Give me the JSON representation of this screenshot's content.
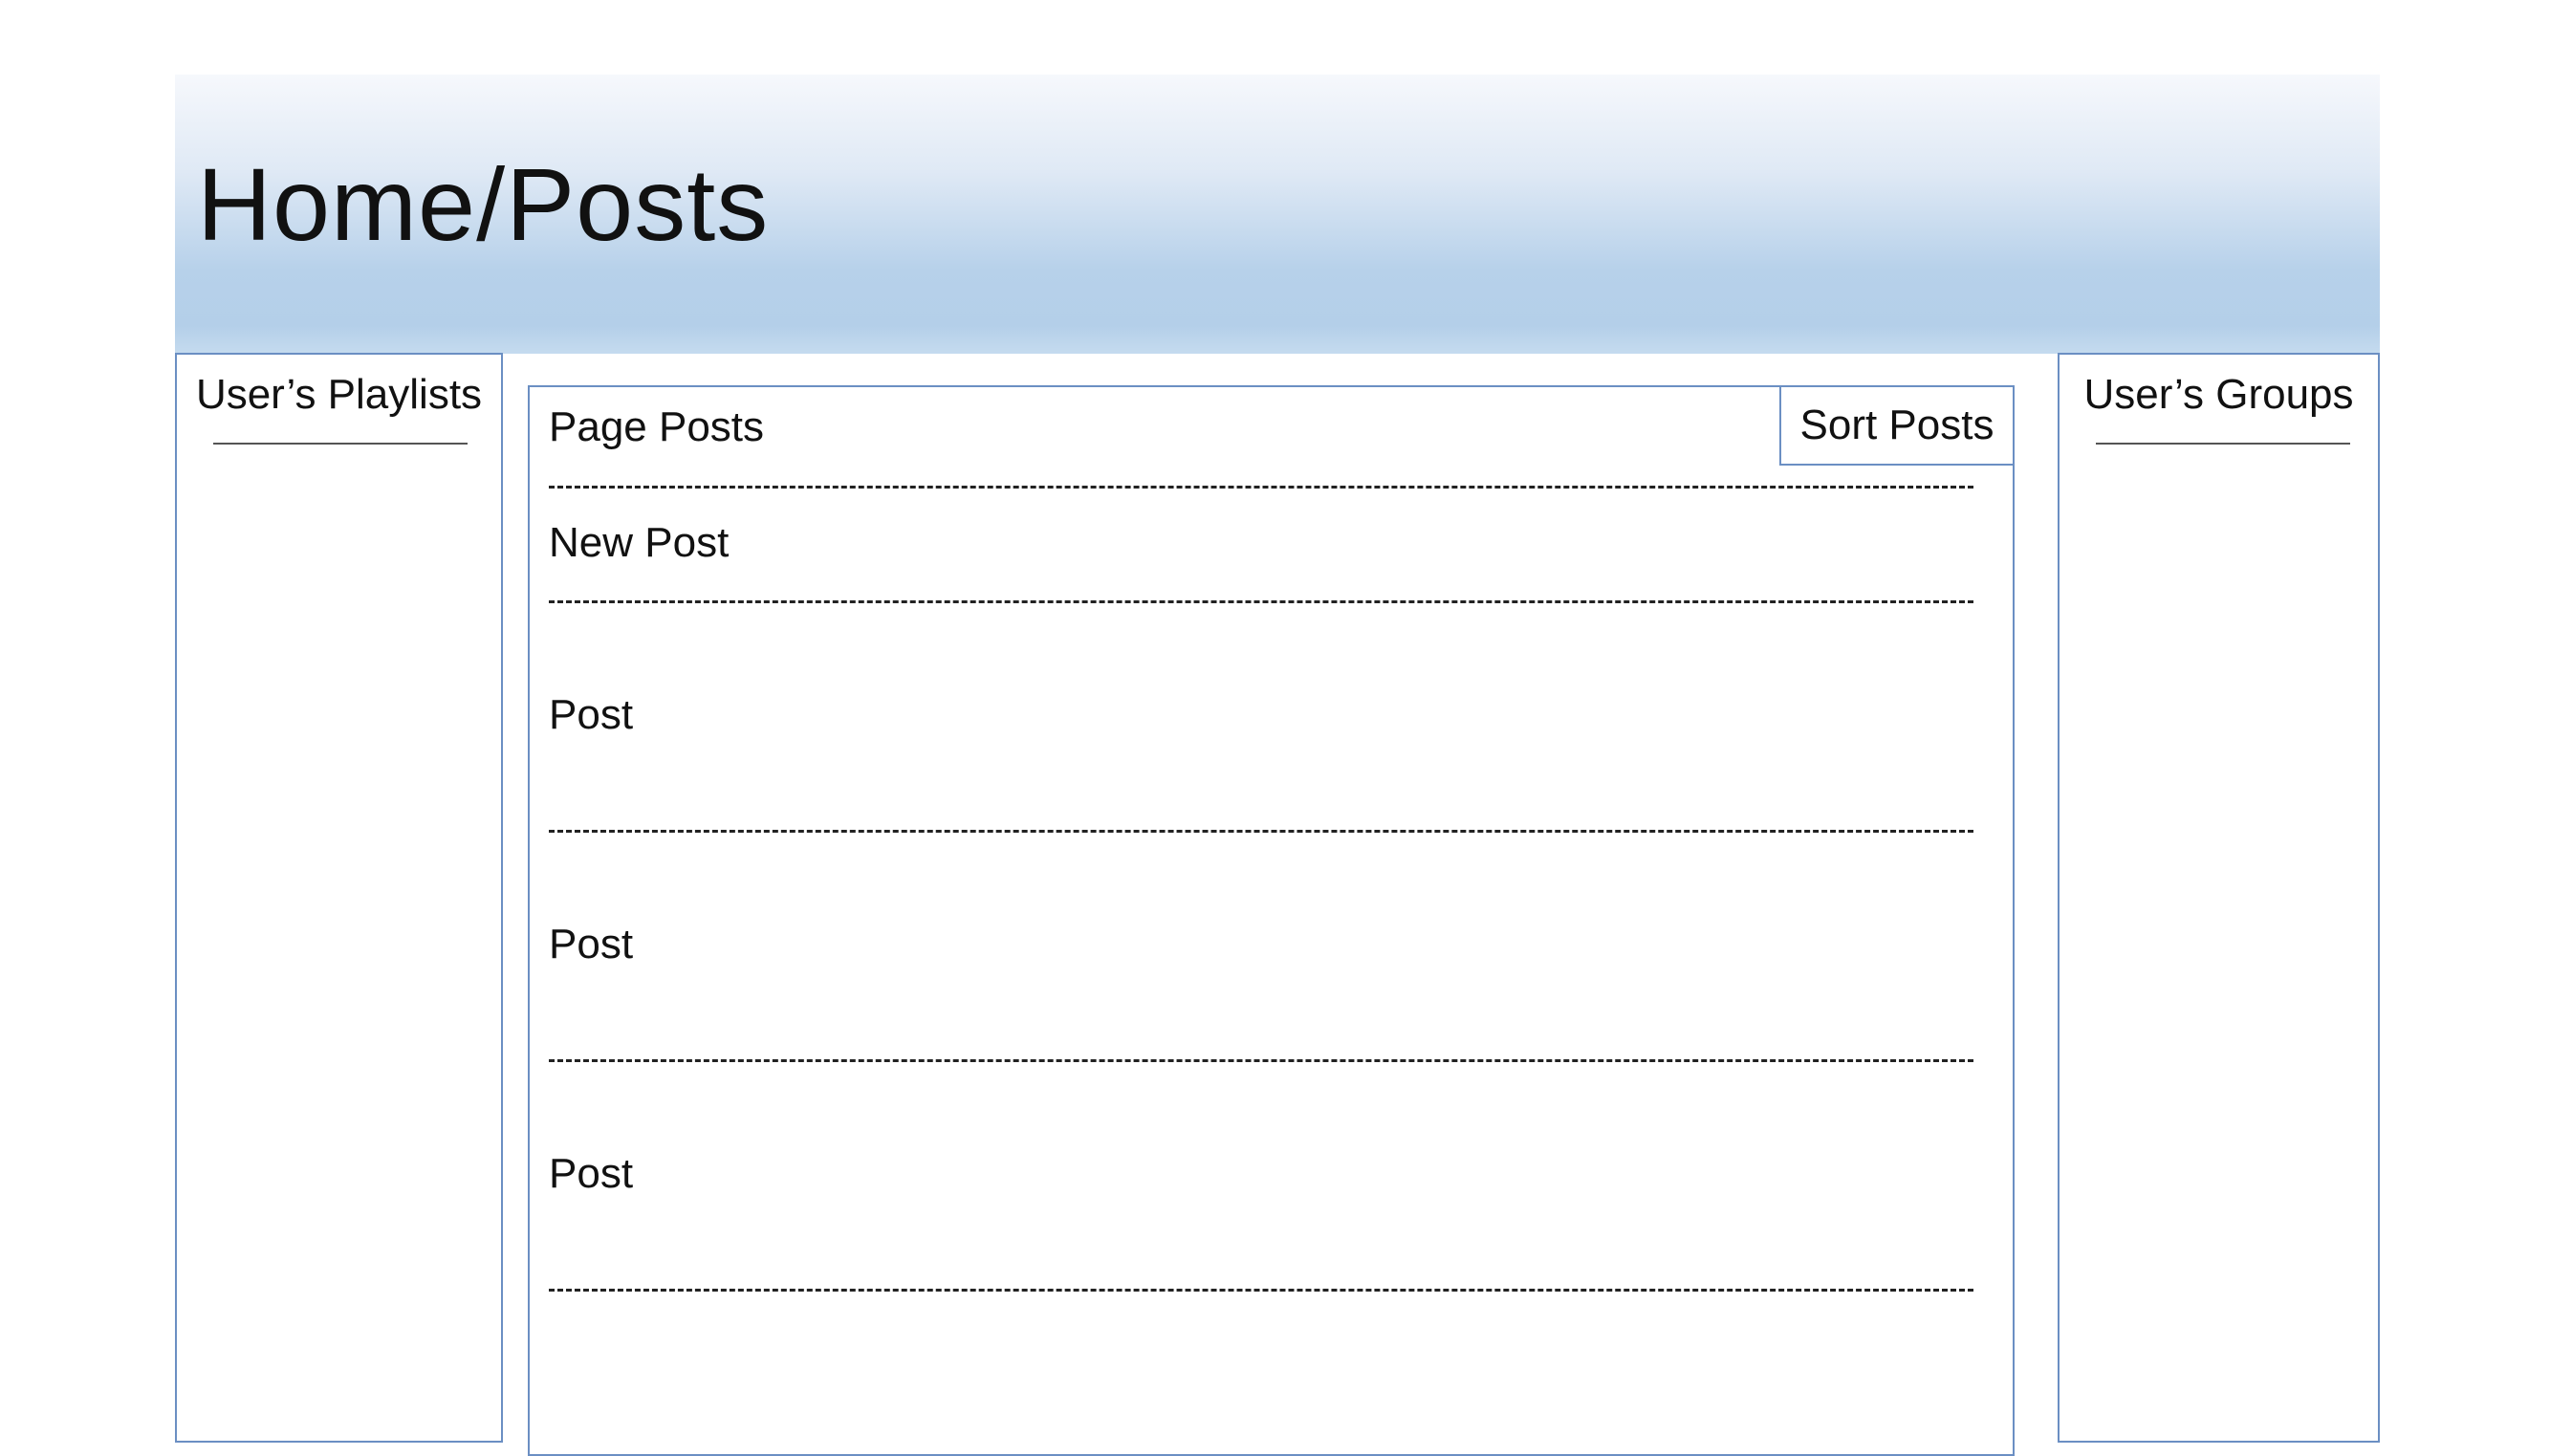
{
  "header": {
    "title": "Home/Posts"
  },
  "left_sidebar": {
    "title": "User’s Playlists"
  },
  "right_sidebar": {
    "title": "User’s Groups"
  },
  "main": {
    "title": "Page Posts",
    "sort_label": "Sort Posts",
    "new_post_label": "New Post",
    "posts": [
      {
        "label": "Post"
      },
      {
        "label": "Post"
      },
      {
        "label": "Post"
      }
    ]
  },
  "colors": {
    "panel_border": "#6b8fc3",
    "header_gradient_top": "#f6f8fc",
    "header_gradient_bottom": "#b4cfe9"
  }
}
